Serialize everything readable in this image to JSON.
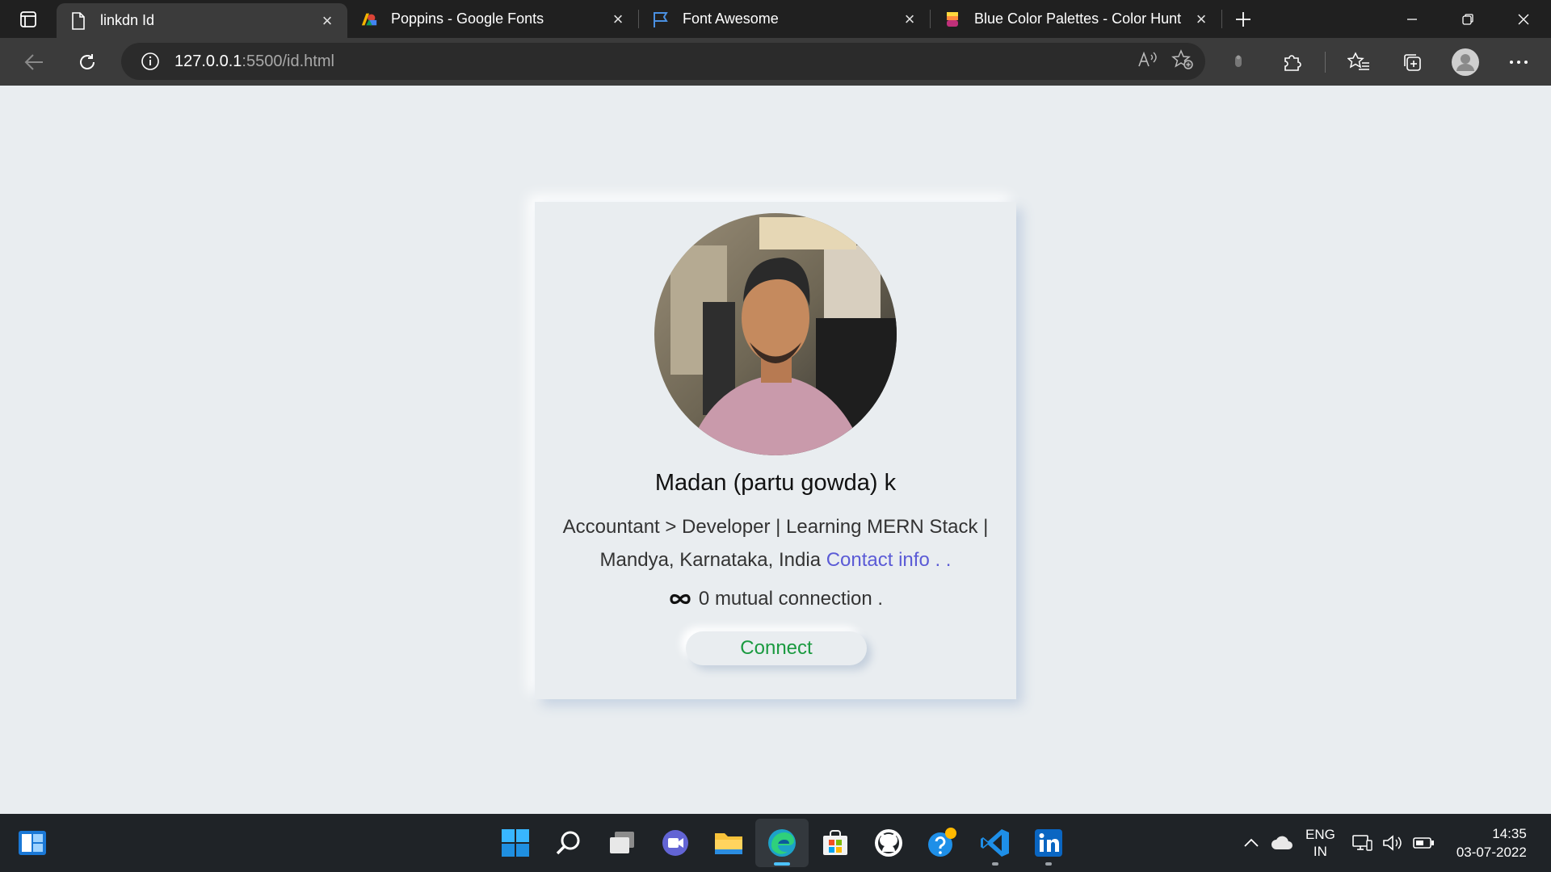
{
  "browser": {
    "tabs": [
      {
        "title": "linkdn Id",
        "icon": "page-icon",
        "active": true
      },
      {
        "title": "Poppins - Google Fonts",
        "icon": "google-fonts-icon",
        "active": false
      },
      {
        "title": "Font Awesome",
        "icon": "flag-icon",
        "active": false
      },
      {
        "title": "Blue Color Palettes - Color Hunt",
        "icon": "color-hunt-icon",
        "active": false
      }
    ],
    "address": {
      "host": "127.0.0.1",
      "path": ":5500/id.html"
    }
  },
  "profile": {
    "name": "Madan (partu gowda) k",
    "headline": "Accountant > Developer | Learning MERN Stack |",
    "location": "Mandya, Karnataka, India",
    "contact_link": "Contact info . .",
    "mutual": "0 mutual connection .",
    "connect_label": "Connect",
    "colors": {
      "background": "#e9edf0",
      "link": "#5b5bd6",
      "connect": "#1a9a40"
    }
  },
  "taskbar": {
    "apps": [
      "start-icon",
      "search-icon",
      "task-view-icon",
      "chat-icon",
      "file-explorer-icon",
      "edge-icon",
      "store-icon",
      "github-icon",
      "help-icon",
      "vscode-icon",
      "linkedin-icon"
    ],
    "lang_line1": "ENG",
    "lang_line2": "IN",
    "time": "14:35",
    "date": "03-07-2022"
  }
}
